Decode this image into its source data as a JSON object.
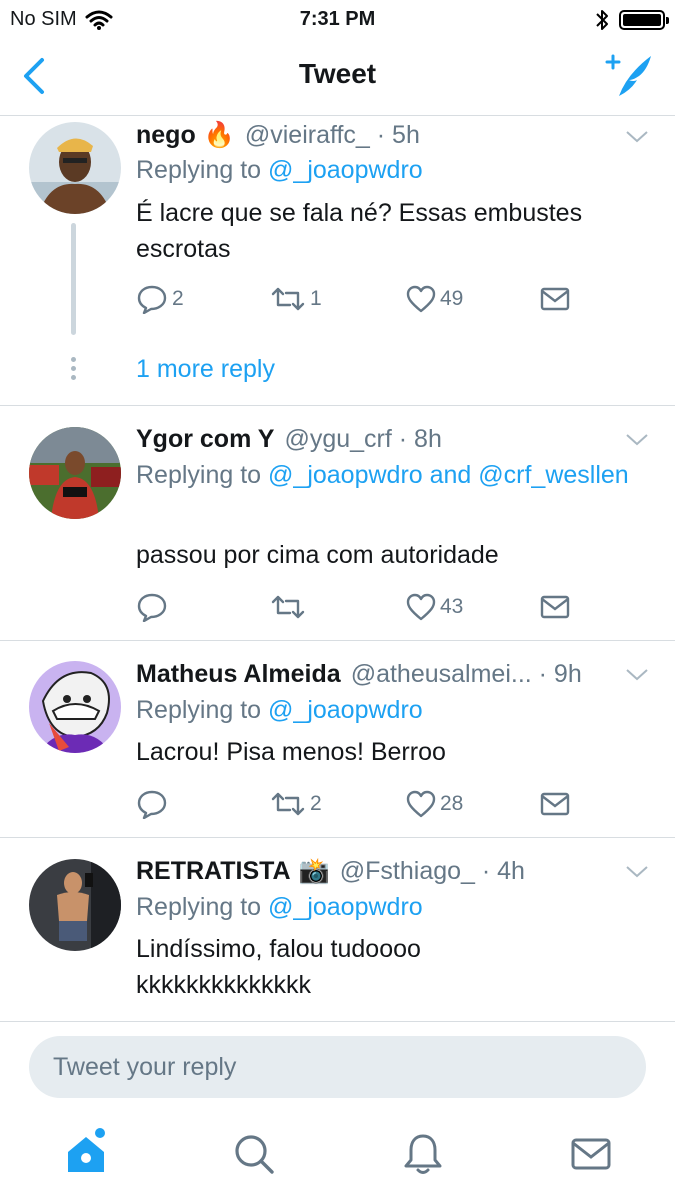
{
  "status_bar": {
    "carrier": "No SIM",
    "time": "7:31 PM"
  },
  "header": {
    "title": "Tweet"
  },
  "tweets": [
    {
      "name": "nego",
      "emoji": "🔥",
      "handle_time": "@vieiraffc_ · 5h",
      "reply_prefix": "Replying to ",
      "mentions": [
        "@_joaopwdro"
      ],
      "text": "É lacre que se fala né? Essas embustes escrotas",
      "replies": "2",
      "retweets": "1",
      "likes": "49"
    },
    {
      "name": "Ygor com Y",
      "handle_time": "@ygu_crf · 8h",
      "reply_prefix": "Replying to ",
      "mentions": [
        "@_joaopwdro",
        "@crf_wesllen"
      ],
      "mention_joiner": " and ",
      "text": "passou por cima com autoridade",
      "replies": "",
      "retweets": "",
      "likes": "43"
    },
    {
      "name": "Matheus Almeida",
      "handle_time": "@atheusalmei... · 9h",
      "reply_prefix": "Replying to ",
      "mentions": [
        "@_joaopwdro"
      ],
      "text": "Lacrou! Pisa menos! Berroo",
      "replies": "",
      "retweets": "2",
      "likes": "28"
    },
    {
      "name": "RETRATISTA",
      "emoji": "📸",
      "handle_time": "@Fsthiago_ · 4h",
      "reply_prefix": "Replying to ",
      "mentions": [
        "@_joaopwdro"
      ],
      "text": "Lindíssimo, falou tudoooo kkkkkkkkkkkkkk",
      "replies": "",
      "retweets": "",
      "likes": ""
    }
  ],
  "thread": {
    "more_replies": "1 more reply"
  },
  "composer": {
    "placeholder": "Tweet your reply"
  },
  "tabs": [
    "home-icon",
    "search-icon",
    "notifications-icon",
    "messages-icon"
  ],
  "colors": {
    "accent": "#1da1f2",
    "secondary_text": "#657786",
    "divider": "#d8dde1"
  }
}
